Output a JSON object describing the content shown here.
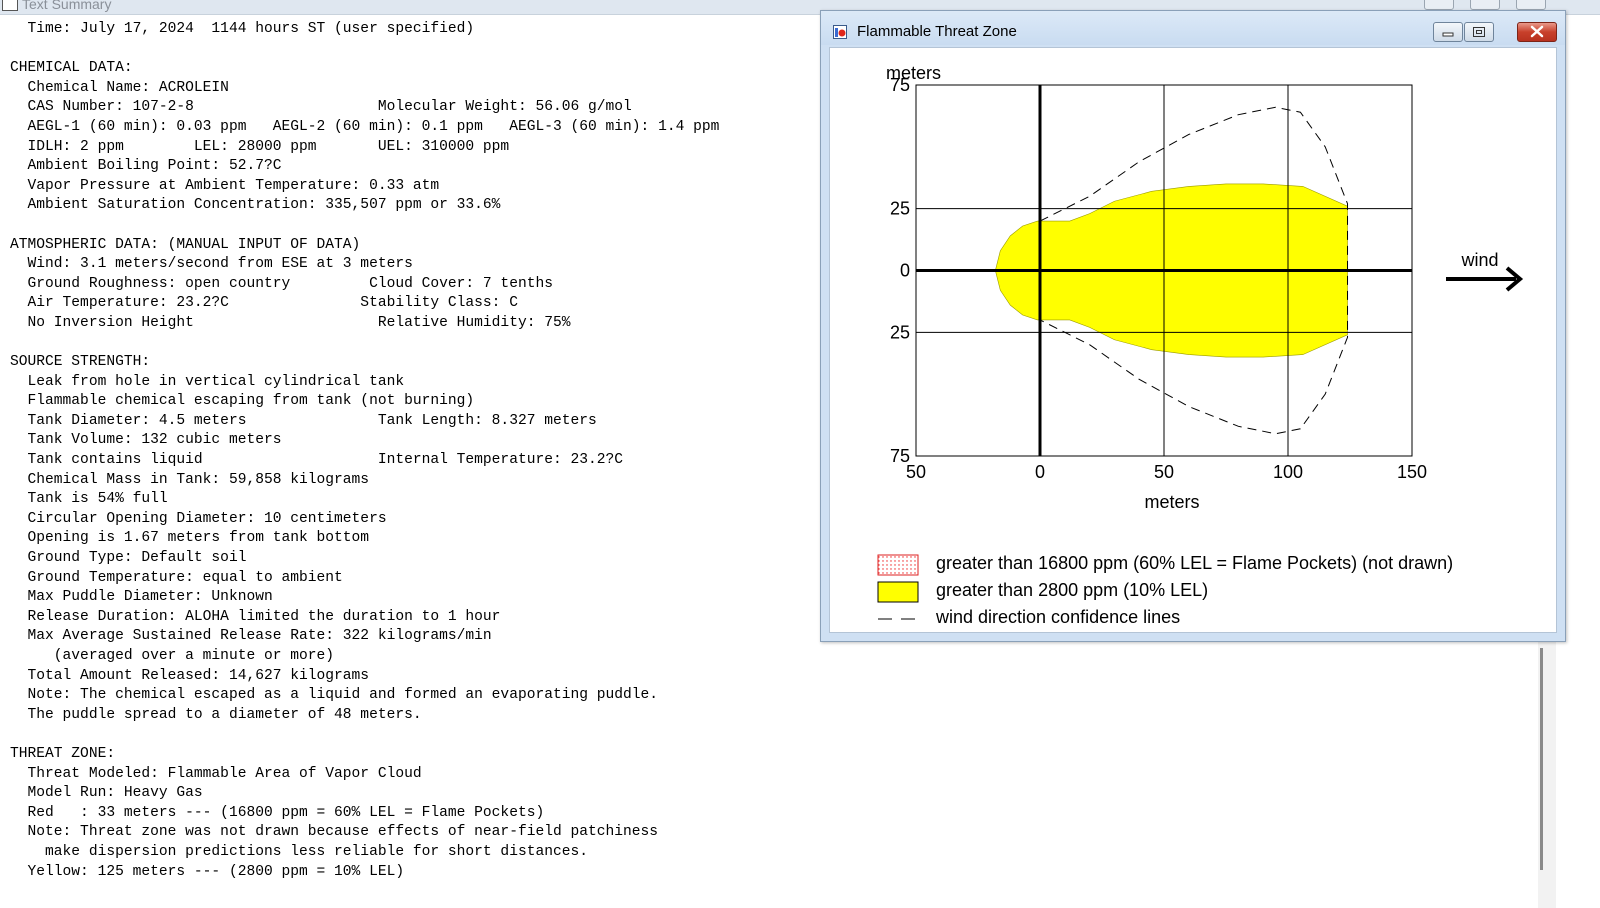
{
  "summary_window": {
    "title": "Text Summary",
    "lines": [
      "  Time: July 17, 2024  1144 hours ST (user specified)",
      "",
      "CHEMICAL DATA:",
      "  Chemical Name: ACROLEIN",
      "  CAS Number: 107-2-8                     Molecular Weight: 56.06 g/mol",
      "  AEGL-1 (60 min): 0.03 ppm   AEGL-2 (60 min): 0.1 ppm   AEGL-3 (60 min): 1.4 ppm",
      "  IDLH: 2 ppm        LEL: 28000 ppm       UEL: 310000 ppm",
      "  Ambient Boiling Point: 52.7?C",
      "  Vapor Pressure at Ambient Temperature: 0.33 atm",
      "  Ambient Saturation Concentration: 335,507 ppm or 33.6%",
      "",
      "ATMOSPHERIC DATA: (MANUAL INPUT OF DATA)",
      "  Wind: 3.1 meters/second from ESE at 3 meters",
      "  Ground Roughness: open country         Cloud Cover: 7 tenths",
      "  Air Temperature: 23.2?C               Stability Class: C",
      "  No Inversion Height                     Relative Humidity: 75%",
      "",
      "SOURCE STRENGTH:",
      "  Leak from hole in vertical cylindrical tank",
      "  Flammable chemical escaping from tank (not burning)",
      "  Tank Diameter: 4.5 meters               Tank Length: 8.327 meters",
      "  Tank Volume: 132 cubic meters",
      "  Tank contains liquid                    Internal Temperature: 23.2?C",
      "  Chemical Mass in Tank: 59,858 kilograms",
      "  Tank is 54% full",
      "  Circular Opening Diameter: 10 centimeters",
      "  Opening is 1.67 meters from tank bottom",
      "  Ground Type: Default soil",
      "  Ground Temperature: equal to ambient",
      "  Max Puddle Diameter: Unknown",
      "  Release Duration: ALOHA limited the duration to 1 hour",
      "  Max Average Sustained Release Rate: 322 kilograms/min",
      "     (averaged over a minute or more)",
      "  Total Amount Released: 14,627 kilograms",
      "  Note: The chemical escaped as a liquid and formed an evaporating puddle.",
      "  The puddle spread to a diameter of 48 meters.",
      "",
      "THREAT ZONE:",
      "  Threat Modeled: Flammable Area of Vapor Cloud",
      "  Model Run: Heavy Gas",
      "  Red   : 33 meters --- (16800 ppm = 60% LEL = Flame Pockets)",
      "  Note: Threat zone was not drawn because effects of near-field patchiness",
      "    make dispersion predictions less reliable for short distances.",
      "  Yellow: 125 meters --- (2800 ppm = 10% LEL)"
    ]
  },
  "threat_window": {
    "title": "Flammable Threat Zone",
    "icons": {
      "app": "threat-zone-app-icon",
      "minimize": "minimize-icon",
      "maximize": "maximize-icon",
      "close": "close-icon"
    },
    "wind_label": "wind",
    "colors": {
      "yellow_zone": "#ffff00",
      "red_zone": "#ff4d4d",
      "axis": "#000000",
      "confidence": "#000000"
    },
    "legend": [
      {
        "swatch": "red-dotted",
        "label": "greater than 16800 ppm (60% LEL = Flame Pockets) (not drawn)"
      },
      {
        "swatch": "yellow",
        "label": "greater than 2800 ppm (10% LEL)"
      },
      {
        "swatch": "dashed-line",
        "label": "wind direction confidence lines"
      }
    ]
  },
  "chart_data": {
    "type": "area",
    "title": "Flammable Threat Zone",
    "xlabel": "meters",
    "ylabel": "meters",
    "xlim": [
      -50,
      150
    ],
    "ylim": [
      -75,
      75
    ],
    "x_ticks": [
      -50,
      0,
      50,
      100,
      150
    ],
    "x_tick_labels": [
      "50",
      "0",
      "50",
      "100",
      "150"
    ],
    "y_ticks": [
      75,
      25,
      0,
      -25,
      -75
    ],
    "y_tick_labels": [
      "75",
      "25",
      "0",
      "25",
      "75"
    ],
    "grid": true,
    "series": [
      {
        "name": "greater than 2800 ppm (10% LEL)",
        "kind": "filled-polygon",
        "points": [
          [
            -18,
            0
          ],
          [
            -16,
            8
          ],
          [
            -12,
            14
          ],
          [
            -7,
            18
          ],
          [
            -1,
            20
          ],
          [
            12,
            20
          ],
          [
            20,
            23
          ],
          [
            30,
            28
          ],
          [
            45,
            32
          ],
          [
            60,
            34
          ],
          [
            75,
            35
          ],
          [
            90,
            35
          ],
          [
            106,
            34
          ],
          [
            124,
            26
          ],
          [
            124,
            -26
          ],
          [
            106,
            -34
          ],
          [
            90,
            -35
          ],
          [
            75,
            -35
          ],
          [
            60,
            -34
          ],
          [
            45,
            -32
          ],
          [
            30,
            -28
          ],
          [
            20,
            -23
          ],
          [
            12,
            -20
          ],
          [
            -1,
            -20
          ],
          [
            -7,
            -18
          ],
          [
            -12,
            -14
          ],
          [
            -16,
            -8
          ],
          [
            -18,
            0
          ]
        ]
      },
      {
        "name": "wind direction confidence lines",
        "kind": "dashed-line",
        "points": [
          [
            0,
            20
          ],
          [
            20,
            30
          ],
          [
            40,
            44
          ],
          [
            60,
            55
          ],
          [
            80,
            63
          ],
          [
            95,
            66
          ],
          [
            105,
            64
          ],
          [
            115,
            50
          ],
          [
            124,
            27
          ],
          [
            124,
            -27
          ],
          [
            115,
            -50
          ],
          [
            105,
            -64
          ],
          [
            95,
            -66
          ],
          [
            80,
            -63
          ],
          [
            60,
            -55
          ],
          [
            40,
            -44
          ],
          [
            20,
            -30
          ],
          [
            0,
            -20
          ]
        ]
      }
    ]
  }
}
